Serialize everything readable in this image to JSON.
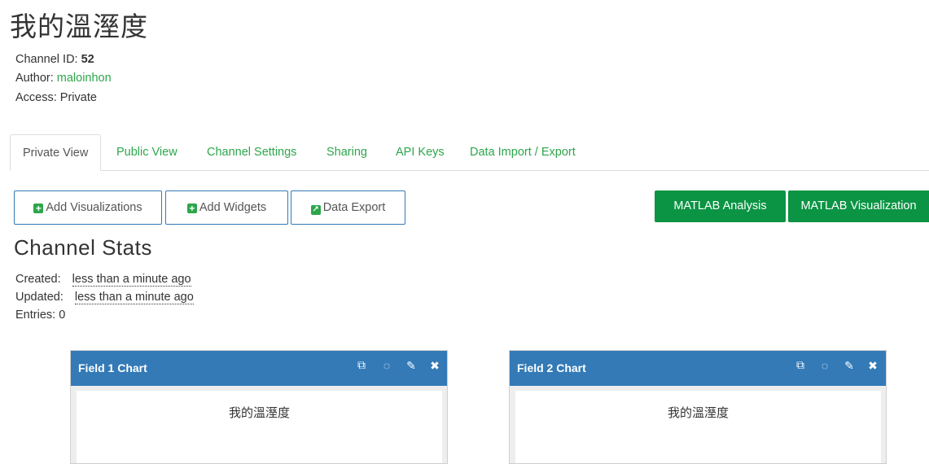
{
  "page": {
    "title": "我的溫溼度"
  },
  "channel": {
    "id_label": "Channel ID:",
    "id_value": "52",
    "author_label": "Author:",
    "author_value": "maloinhon",
    "access_label": "Access:",
    "access_value": "Private"
  },
  "tabs": [
    {
      "label": "Private View"
    },
    {
      "label": "Public View"
    },
    {
      "label": "Channel Settings"
    },
    {
      "label": "Sharing"
    },
    {
      "label": "API Keys"
    },
    {
      "label": "Data Import / Export"
    }
  ],
  "toolbar": {
    "add_visualizations": "Add Visualizations",
    "add_widgets": "Add Widgets",
    "data_export": "Data Export",
    "matlab_analysis": "MATLAB Analysis",
    "matlab_visualization": "MATLAB Visualization"
  },
  "stats": {
    "title": "Channel Stats",
    "created_label": "Created:",
    "created_value": "less than a minute ago",
    "updated_label": "Updated:",
    "updated_value": "less than a minute ago",
    "entries_label": "Entries:",
    "entries_value": "0"
  },
  "charts": [
    {
      "header": "Field 1 Chart",
      "chart_title": "我的溫溼度"
    },
    {
      "header": "Field 2 Chart",
      "chart_title": "我的溫溼度"
    }
  ],
  "colors": {
    "accent_green": "#2ca64a",
    "matlab_button": "#0b9444",
    "panel_header": "#337ab7"
  },
  "icons": {
    "plus": "plus-square-icon",
    "export": "external-link-icon",
    "popout": "popout-icon",
    "comment": "comment-icon",
    "edit": "pencil-icon",
    "close": "close-icon"
  }
}
